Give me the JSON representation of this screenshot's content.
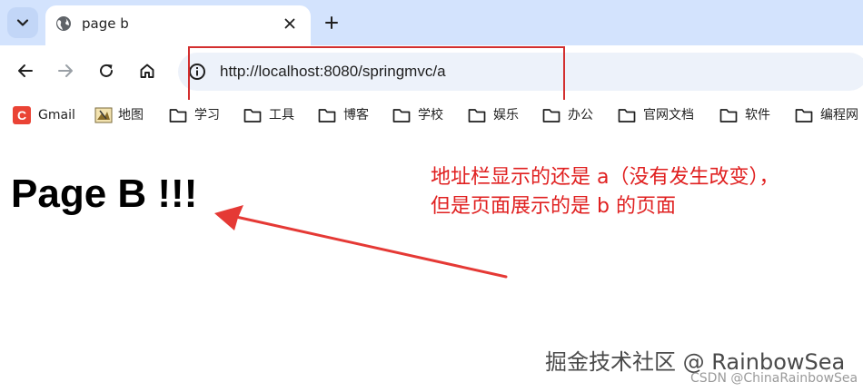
{
  "tabstrip": {
    "search_icon": "chevron-down-icon",
    "active_tab": {
      "title": "page b",
      "favicon": "globe-icon"
    },
    "new_tab_icon": "plus-icon"
  },
  "toolbar": {
    "back_icon": "arrow-left-icon",
    "forward_icon": "arrow-right-icon",
    "reload_icon": "reload-icon",
    "home_icon": "home-icon",
    "site_info_icon": "info-icon",
    "url": "http://localhost:8080/springmvc/a",
    "highlight_color": "#d32f2f"
  },
  "bookmarks": [
    {
      "label": "Gmail",
      "icon": "gmail-icon"
    },
    {
      "label": "地图",
      "icon": "map-icon"
    },
    {
      "label": "学习",
      "icon": "folder-icon"
    },
    {
      "label": "工具",
      "icon": "folder-icon"
    },
    {
      "label": "博客",
      "icon": "folder-icon"
    },
    {
      "label": "学校",
      "icon": "folder-icon"
    },
    {
      "label": "娱乐",
      "icon": "folder-icon"
    },
    {
      "label": "办公",
      "icon": "folder-icon"
    },
    {
      "label": "官网文档",
      "icon": "folder-icon"
    },
    {
      "label": "软件",
      "icon": "folder-icon"
    },
    {
      "label": "编程网",
      "icon": "folder-icon"
    }
  ],
  "page": {
    "heading": "Page B !!!",
    "annotation": {
      "line1": "地址栏显示的还是 a（没有发生改变），",
      "line2": "但是页面展示的是 b 的页面",
      "color": "#e02020"
    },
    "watermark": "掘金技术社区 @ RainbowSea",
    "watermark_small": "CSDN @ChinaRainbowSea"
  }
}
